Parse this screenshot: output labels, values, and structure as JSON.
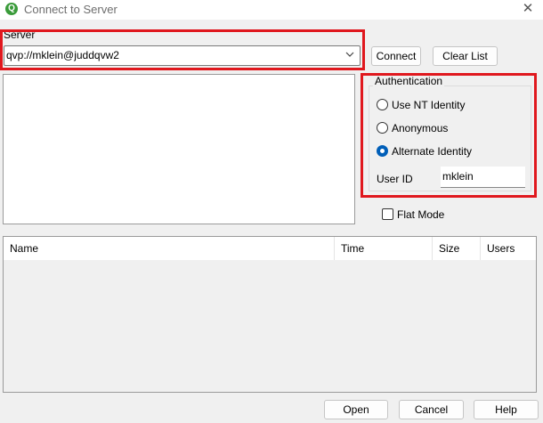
{
  "window": {
    "title": "Connect to Server",
    "icon_letter": "Q",
    "close_glyph": "✕"
  },
  "server": {
    "label": "Server",
    "value": "qvp://mklein@juddqvw2"
  },
  "buttons": {
    "connect": "Connect",
    "clear_list": "Clear List",
    "open": "Open",
    "cancel": "Cancel",
    "help": "Help"
  },
  "authentication": {
    "title": "Authentication",
    "options": [
      {
        "label": "Use NT Identity",
        "checked": false
      },
      {
        "label": "Anonymous",
        "checked": false
      },
      {
        "label": "Alternate Identity",
        "checked": true
      }
    ],
    "user_id_label": "User ID",
    "user_id_value": "mklein"
  },
  "flat_mode": {
    "label": "Flat Mode",
    "checked": false
  },
  "document_list": {
    "columns": [
      "Name",
      "Time",
      "Size",
      "Users"
    ],
    "rows": []
  },
  "colors": {
    "highlight": "#e0181e",
    "accent": "#005fb8",
    "background": "#f0f0f0"
  }
}
